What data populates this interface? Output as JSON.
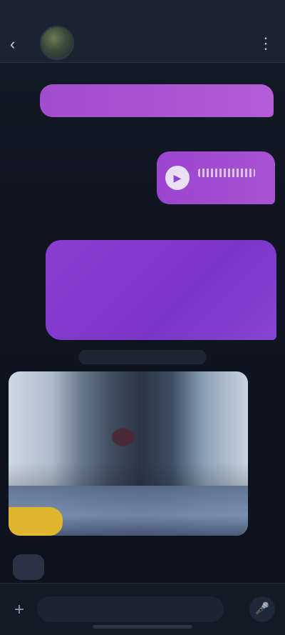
{
  "header": {
    "time": "",
    "contact_name": "",
    "status": ""
  },
  "messages": {
    "m1": "",
    "m2_duration": "",
    "m3": ""
  },
  "timestamps": {
    "t1": "",
    "t2": ""
  },
  "date_pill": "",
  "media": {
    "badge": "",
    "caption": ""
  },
  "reaction": "",
  "composer": {
    "placeholder": ""
  },
  "icons": {
    "back": "back-chevron-icon",
    "menu": "more-vertical-icon",
    "play": "play-icon",
    "plus": "plus-icon",
    "mic": "microphone-icon",
    "reaction": "emoji-icon"
  },
  "colors": {
    "accent": "#a24ccf",
    "accent_dark": "#7b35c8",
    "badge": "#e1b62f",
    "background": "#0f1521"
  }
}
